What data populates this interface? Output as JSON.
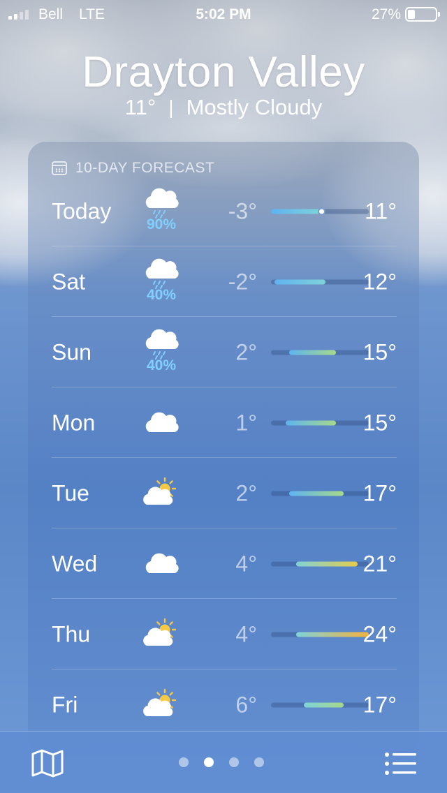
{
  "status_bar": {
    "carrier": "Bell",
    "network": "LTE",
    "time": "5:02 PM",
    "battery_percent": "27%",
    "battery_level": 0.27,
    "signal_bars": 2
  },
  "location": {
    "city": "Drayton Valley",
    "current_temp": "11°",
    "separator": "|",
    "condition": "Mostly Cloudy"
  },
  "forecast": {
    "header_icon": "calendar-icon",
    "title": "10-DAY FORECAST",
    "scale_min": -3,
    "scale_max": 24,
    "current_temp_value": 11,
    "days": [
      {
        "day": "Today",
        "icon": "rain-cloud-icon",
        "precip": "90%",
        "low": "-3°",
        "high": "11°",
        "low_value": -3,
        "high_value": 11,
        "show_now": true
      },
      {
        "day": "Sat",
        "icon": "cloud-drizzle-icon",
        "precip": "40%",
        "low": "-2°",
        "high": "12°",
        "low_value": -2,
        "high_value": 12,
        "show_now": false
      },
      {
        "day": "Sun",
        "icon": "cloud-drizzle-icon",
        "precip": "40%",
        "low": "2°",
        "high": "15°",
        "low_value": 2,
        "high_value": 15,
        "show_now": false
      },
      {
        "day": "Mon",
        "icon": "cloud-icon",
        "precip": "",
        "low": "1°",
        "high": "15°",
        "low_value": 1,
        "high_value": 15,
        "show_now": false
      },
      {
        "day": "Tue",
        "icon": "partly-sunny-icon",
        "precip": "",
        "low": "2°",
        "high": "17°",
        "low_value": 2,
        "high_value": 17,
        "show_now": false
      },
      {
        "day": "Wed",
        "icon": "cloud-icon",
        "precip": "",
        "low": "4°",
        "high": "21°",
        "low_value": 4,
        "high_value": 21,
        "show_now": false
      },
      {
        "day": "Thu",
        "icon": "partly-sunny-icon",
        "precip": "",
        "low": "4°",
        "high": "24°",
        "low_value": 4,
        "high_value": 24,
        "show_now": false
      },
      {
        "day": "Fri",
        "icon": "partly-sunny-icon",
        "precip": "",
        "low": "6°",
        "high": "17°",
        "low_value": 6,
        "high_value": 17,
        "show_now": false
      }
    ]
  },
  "toolbar": {
    "map_icon": "map-icon",
    "list_icon": "list-icon",
    "page_count": 4,
    "active_page": 2
  },
  "colors": {
    "precip": "#7fd0ff",
    "cold": "#5fb3f0",
    "cool": "#7fd3d8",
    "mild": "#a6d98a",
    "warm": "#e6cc4a",
    "hot": "#f2b33d"
  }
}
